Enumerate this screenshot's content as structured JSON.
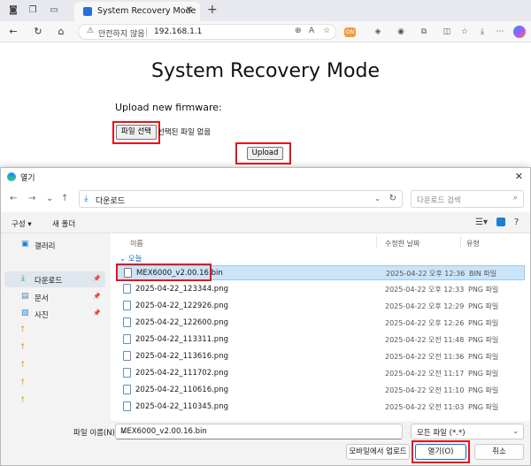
{
  "browser": {
    "tab_title": "System Recovery Mode",
    "security_label": "안전하지 않음",
    "url": "192.168.1.1",
    "ext_badge": "ON"
  },
  "page": {
    "title": "System Recovery Mode",
    "upload_label": "Upload new firmware:",
    "file_button": "파일 선택",
    "no_file_text": "선택된 파일 없음",
    "upload_button": "Upload"
  },
  "dialog": {
    "title": "열기",
    "path": "다운로드",
    "search_placeholder": "다운로드 검색",
    "cmd": {
      "organize": "구성 ▾",
      "new_folder": "새 폴더"
    },
    "sidebar": {
      "gallery": "갤러리",
      "downloads": "다운로드",
      "documents": "문서",
      "pictures": "사진"
    },
    "columns": {
      "name": "이름",
      "modified": "수정한 날짜",
      "type": "유형"
    },
    "group": "오늘",
    "files": [
      {
        "name": "MEX6000_v2.00.16.bin",
        "date": "2025-04-22 오후 12:36",
        "type": "BIN 파일"
      },
      {
        "name": "2025-04-22_123344.png",
        "date": "2025-04-22 오후 12:33",
        "type": "PNG 파일"
      },
      {
        "name": "2025-04-22_122926.png",
        "date": "2025-04-22 오후 12:29",
        "type": "PNG 파일"
      },
      {
        "name": "2025-04-22_122600.png",
        "date": "2025-04-22 오후 12:26",
        "type": "PNG 파일"
      },
      {
        "name": "2025-04-22_113311.png",
        "date": "2025-04-22 오전 11:48",
        "type": "PNG 파일"
      },
      {
        "name": "2025-04-22_113616.png",
        "date": "2025-04-22 오전 11:36",
        "type": "PNG 파일"
      },
      {
        "name": "2025-04-22_111702.png",
        "date": "2025-04-22 오전 11:17",
        "type": "PNG 파일"
      },
      {
        "name": "2025-04-22_110616.png",
        "date": "2025-04-22 오전 11:10",
        "type": "PNG 파일"
      },
      {
        "name": "2025-04-22_110345.png",
        "date": "2025-04-22 오전 11:03",
        "type": "PNG 파일"
      }
    ],
    "filename_label": "파일 이름(N):",
    "filename_value": "MEX6000_v2.00.16.bin",
    "filetype_value": "모든 파일 (*.*)",
    "mobile_upload": "모바일에서 업로드",
    "open_button": "열기(O)",
    "cancel_button": "취소"
  },
  "colors": {
    "highlight": "#e3141e",
    "selection": "#cce4f7",
    "accent": "#1b6ec2"
  }
}
